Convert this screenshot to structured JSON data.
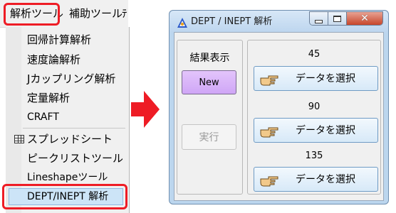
{
  "menubar": {
    "analysis_menu": "解析ツール",
    "aux_menu": "補助ツール",
    "cut_off_menu": "ﾃ"
  },
  "dropdown": {
    "items": [
      "回帰計算解析",
      "速度論解析",
      "Jカップリング解析",
      "定量解析",
      "CRAFT",
      "スプレッドシート",
      "ピークリストツール",
      "Lineshapeツール",
      "DEPT/INEPT 解析"
    ],
    "selected_item": "DEPT/INEPT 解析"
  },
  "window": {
    "title": "DEPT / INEPT 解析",
    "result_label": "結果表示",
    "new_button": "New",
    "run_button": "実行",
    "rows": [
      {
        "angle": "45",
        "select_label": "データを選択"
      },
      {
        "angle": "90",
        "select_label": "データを選択"
      },
      {
        "angle": "135",
        "select_label": "データを選択"
      }
    ],
    "close_glyph": "✕"
  },
  "colors": {
    "highlight_frame": "#ee1c25",
    "arrow": "#ee1c25",
    "new_button_fill": "#d8b4f8",
    "select_button_fill": "#e3eff9",
    "window_frame": "#bcd6ee"
  }
}
